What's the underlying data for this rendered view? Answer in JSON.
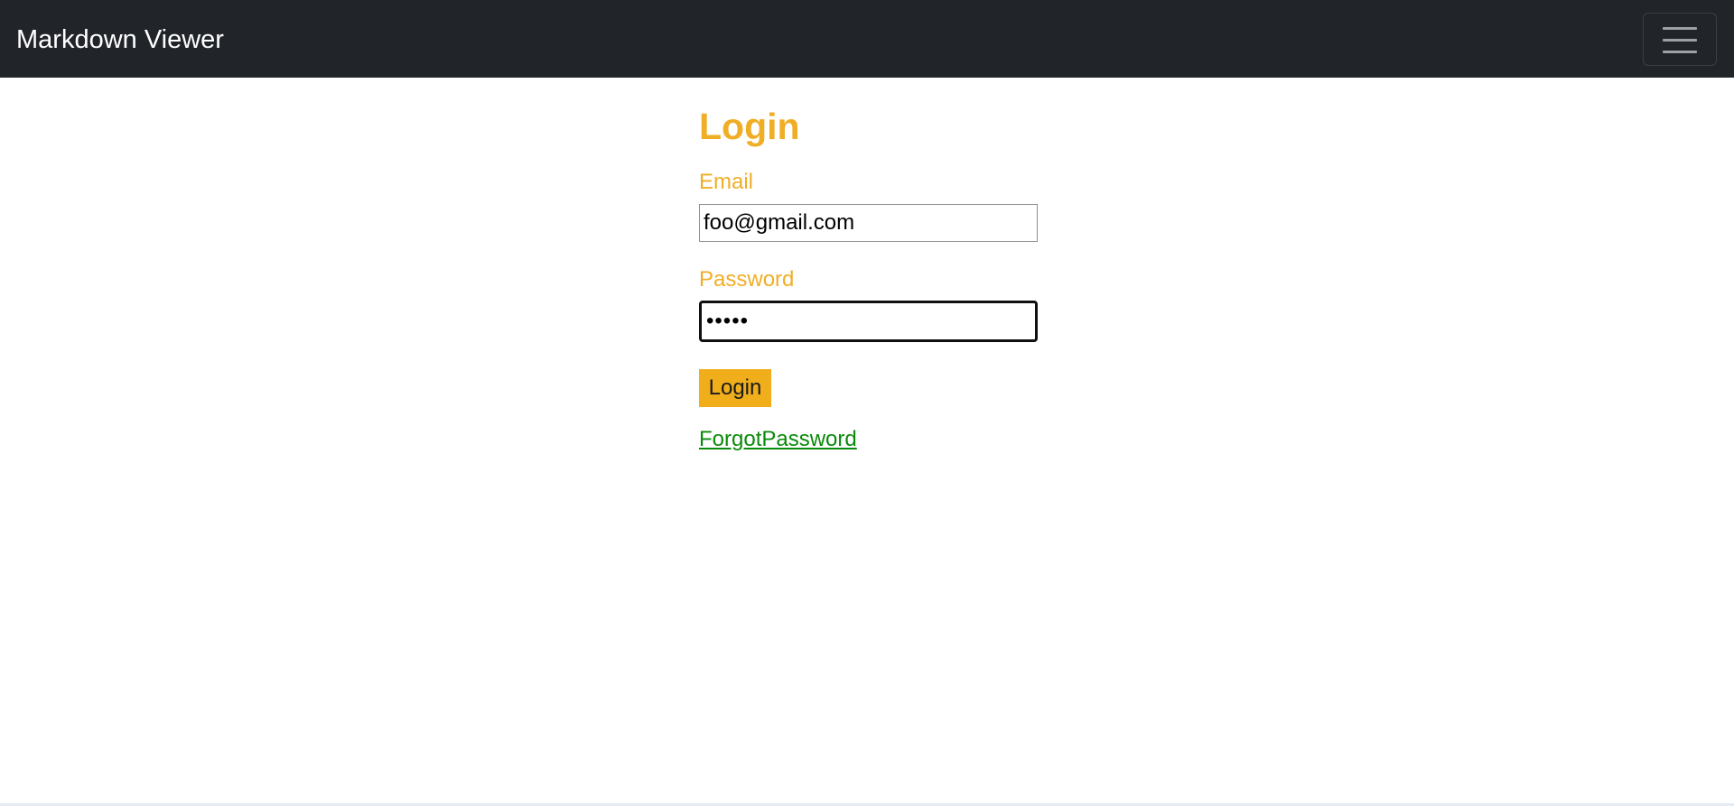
{
  "navbar": {
    "brand": "Markdown Viewer",
    "toggler_icon": "hamburger-menu-icon",
    "background_color": "#212529"
  },
  "login_form": {
    "title": "Login",
    "email_label": "Email",
    "email_value": "foo@gmail.com",
    "password_label": "Password",
    "password_value": "•••••",
    "submit_label": "Login",
    "forgot_password_link": "ForgotPassword",
    "accent_color": "#f0ae26",
    "link_color": "#0a8a0a"
  }
}
